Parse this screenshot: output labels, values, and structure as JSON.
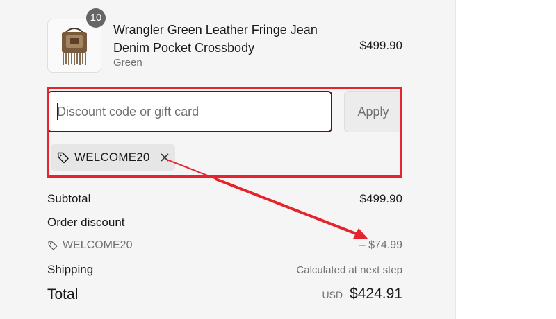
{
  "product": {
    "name": "Wrangler Green Leather Fringe Jean Denim Pocket Crossbody",
    "variant": "Green",
    "price": "$499.90",
    "quantity": "10",
    "thumbnail_icon": "bag-thumbnail"
  },
  "discount": {
    "placeholder": "Discount code or gift card",
    "value": "",
    "apply_label": "Apply",
    "applied_code": "WELCOME20",
    "tag_icon": "tag-icon",
    "remove_icon": "close-icon"
  },
  "summary": {
    "subtotal_label": "Subtotal",
    "subtotal_value": "$499.90",
    "order_discount_label": "Order discount",
    "discount_code": "WELCOME20",
    "discount_value": "– $74.99",
    "shipping_label": "Shipping",
    "shipping_value": "Calculated at next step",
    "total_label": "Total",
    "currency": "USD",
    "total_value": "$424.91"
  },
  "colors": {
    "annotation_red": "#e5252d",
    "input_border": "#5a1414",
    "panel_bg": "#f5f5f5"
  }
}
